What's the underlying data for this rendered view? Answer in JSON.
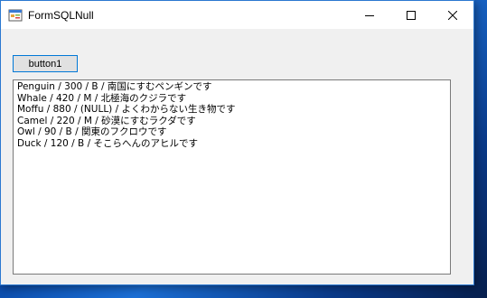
{
  "window": {
    "title": "FormSQLNull"
  },
  "titlebar": {
    "icons": {
      "app": "winforms-app-icon",
      "minimize": "minimize-icon",
      "maximize": "maximize-icon",
      "close": "close-icon"
    }
  },
  "toolbar": {
    "button1_label": "button1"
  },
  "output": {
    "lines": [
      "Penguin / 300 / B / 南国にすむペンギンです",
      "Whale / 420 / M / 北極海のクジラです",
      "Moffu / 880 / (NULL) / よくわからない生き物です",
      "Camel / 220 / M / 砂漠にすむラクダです",
      "Owl / 90 / B / 関東のフクロウです",
      "Duck / 120 / B / そこらへんのアヒルです"
    ]
  },
  "colors": {
    "accent": "#0078d7",
    "window_bg": "#f0f0f0",
    "textbox_bg": "#ffffff"
  }
}
